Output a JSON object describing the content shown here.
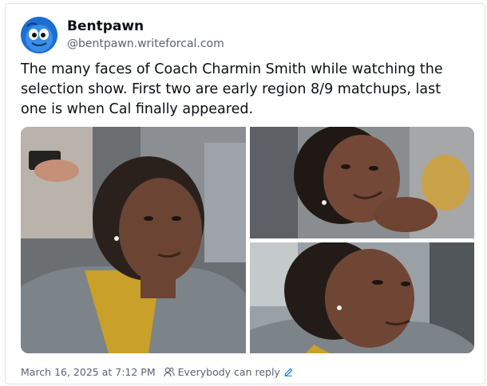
{
  "post": {
    "author_name": "Bentpawn",
    "author_handle": "@bentpawn.writeforcal.com",
    "text": "The many faces of Coach Charmin Smith while watching the selection show. First two are early region 8/9 matchups, last one is when Cal finally appeared.",
    "timestamp": "March 16, 2025 at 7:12 PM",
    "reply_setting": "Everybody can reply"
  },
  "icons": {
    "avatar": "blue-cartoon-face-avatar",
    "people": "people-icon",
    "edit": "pencil-icon"
  },
  "colors": {
    "text": "#0b0f14",
    "secondary": "#59636e",
    "avatar_bg": "#2e7fd8",
    "edit_link": "#1083fe"
  }
}
